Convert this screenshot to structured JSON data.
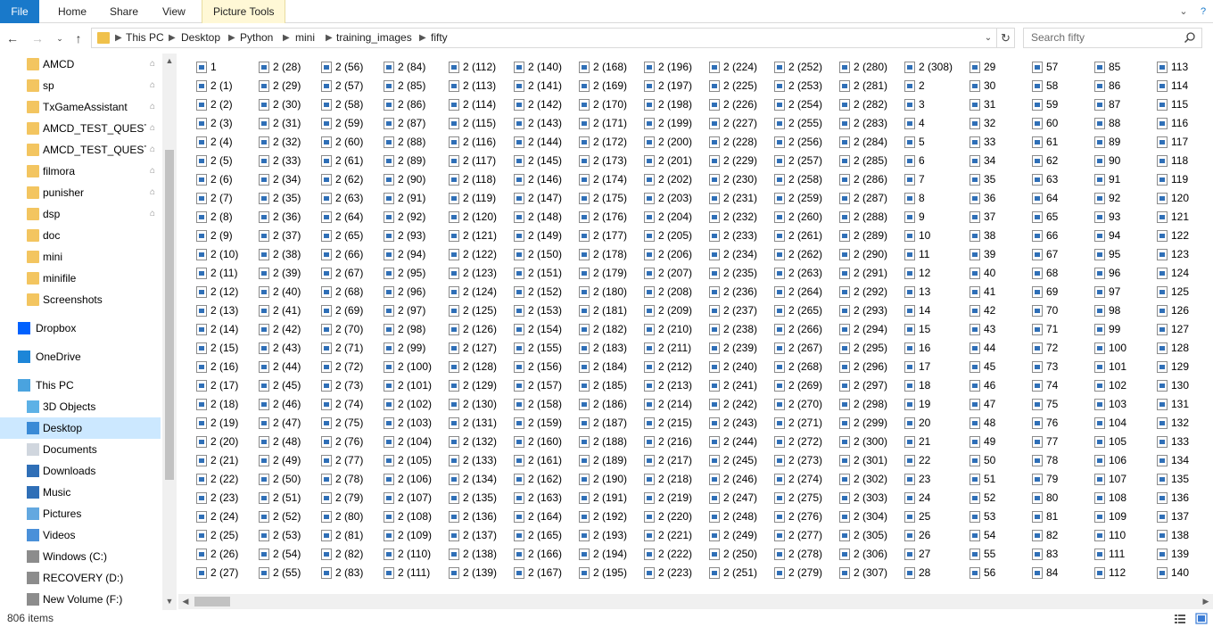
{
  "ribbon": {
    "file_label": "File",
    "tabs": [
      "Home",
      "Share",
      "View"
    ],
    "tools_label": "Picture Tools"
  },
  "address": {
    "crumbs": [
      "This PC",
      "Desktop",
      "Python",
      "mini",
      "training_images",
      "fifty"
    ],
    "search_placeholder": "Search fifty"
  },
  "nav": {
    "quick": [
      {
        "label": "AMCD",
        "pinned": true
      },
      {
        "label": "sp",
        "pinned": true
      },
      {
        "label": "TxGameAssistant",
        "pinned": true
      },
      {
        "label": "AMCD_TEST_QUESTIO",
        "pinned": true
      },
      {
        "label": "AMCD_TEST_QUESTIO",
        "pinned": true
      },
      {
        "label": "filmora",
        "pinned": true
      },
      {
        "label": "punisher",
        "pinned": true
      },
      {
        "label": "dsp",
        "pinned": true
      },
      {
        "label": "doc",
        "pinned": false
      },
      {
        "label": "mini",
        "pinned": false
      },
      {
        "label": "minifile",
        "pinned": false
      },
      {
        "label": "Screenshots",
        "pinned": false
      }
    ],
    "dropbox": "Dropbox",
    "onedrive": "OneDrive",
    "thispc": "This PC",
    "pc_items": [
      {
        "label": "3D Objects",
        "icon": "cube-icon"
      },
      {
        "label": "Desktop",
        "icon": "desktop-icon",
        "selected": true
      },
      {
        "label": "Documents",
        "icon": "documents-icon"
      },
      {
        "label": "Downloads",
        "icon": "download-icon"
      },
      {
        "label": "Music",
        "icon": "music-icon"
      },
      {
        "label": "Pictures",
        "icon": "pictures-icon"
      },
      {
        "label": "Videos",
        "icon": "videos-icon"
      },
      {
        "label": "Windows (C:)",
        "icon": "drive-icon"
      },
      {
        "label": "RECOVERY (D:)",
        "icon": "drive-icon"
      },
      {
        "label": "New Volume (F:)",
        "icon": "drive-icon"
      }
    ]
  },
  "files": {
    "columns": [
      [
        "1",
        "2 (1)",
        "2 (2)",
        "2 (3)",
        "2 (4)",
        "2 (5)",
        "2 (6)",
        "2 (7)",
        "2 (8)",
        "2 (9)",
        "2 (10)",
        "2 (11)",
        "2 (12)",
        "2 (13)",
        "2 (14)",
        "2 (15)",
        "2 (16)",
        "2 (17)",
        "2 (18)",
        "2 (19)",
        "2 (20)",
        "2 (21)",
        "2 (22)",
        "2 (23)",
        "2 (24)",
        "2 (25)",
        "2 (26)",
        "2 (27)"
      ],
      [
        "2 (28)",
        "2 (29)",
        "2 (30)",
        "2 (31)",
        "2 (32)",
        "2 (33)",
        "2 (34)",
        "2 (35)",
        "2 (36)",
        "2 (37)",
        "2 (38)",
        "2 (39)",
        "2 (40)",
        "2 (41)",
        "2 (42)",
        "2 (43)",
        "2 (44)",
        "2 (45)",
        "2 (46)",
        "2 (47)",
        "2 (48)",
        "2 (49)",
        "2 (50)",
        "2 (51)",
        "2 (52)",
        "2 (53)",
        "2 (54)",
        "2 (55)"
      ],
      [
        "2 (56)",
        "2 (57)",
        "2 (58)",
        "2 (59)",
        "2 (60)",
        "2 (61)",
        "2 (62)",
        "2 (63)",
        "2 (64)",
        "2 (65)",
        "2 (66)",
        "2 (67)",
        "2 (68)",
        "2 (69)",
        "2 (70)",
        "2 (71)",
        "2 (72)",
        "2 (73)",
        "2 (74)",
        "2 (75)",
        "2 (76)",
        "2 (77)",
        "2 (78)",
        "2 (79)",
        "2 (80)",
        "2 (81)",
        "2 (82)",
        "2 (83)"
      ],
      [
        "2 (84)",
        "2 (85)",
        "2 (86)",
        "2 (87)",
        "2 (88)",
        "2 (89)",
        "2 (90)",
        "2 (91)",
        "2 (92)",
        "2 (93)",
        "2 (94)",
        "2 (95)",
        "2 (96)",
        "2 (97)",
        "2 (98)",
        "2 (99)",
        "2 (100)",
        "2 (101)",
        "2 (102)",
        "2 (103)",
        "2 (104)",
        "2 (105)",
        "2 (106)",
        "2 (107)",
        "2 (108)",
        "2 (109)",
        "2 (110)",
        "2 (111)"
      ],
      [
        "2 (112)",
        "2 (113)",
        "2 (114)",
        "2 (115)",
        "2 (116)",
        "2 (117)",
        "2 (118)",
        "2 (119)",
        "2 (120)",
        "2 (121)",
        "2 (122)",
        "2 (123)",
        "2 (124)",
        "2 (125)",
        "2 (126)",
        "2 (127)",
        "2 (128)",
        "2 (129)",
        "2 (130)",
        "2 (131)",
        "2 (132)",
        "2 (133)",
        "2 (134)",
        "2 (135)",
        "2 (136)",
        "2 (137)",
        "2 (138)",
        "2 (139)"
      ],
      [
        "2 (140)",
        "2 (141)",
        "2 (142)",
        "2 (143)",
        "2 (144)",
        "2 (145)",
        "2 (146)",
        "2 (147)",
        "2 (148)",
        "2 (149)",
        "2 (150)",
        "2 (151)",
        "2 (152)",
        "2 (153)",
        "2 (154)",
        "2 (155)",
        "2 (156)",
        "2 (157)",
        "2 (158)",
        "2 (159)",
        "2 (160)",
        "2 (161)",
        "2 (162)",
        "2 (163)",
        "2 (164)",
        "2 (165)",
        "2 (166)",
        "2 (167)"
      ],
      [
        "2 (168)",
        "2 (169)",
        "2 (170)",
        "2 (171)",
        "2 (172)",
        "2 (173)",
        "2 (174)",
        "2 (175)",
        "2 (176)",
        "2 (177)",
        "2 (178)",
        "2 (179)",
        "2 (180)",
        "2 (181)",
        "2 (182)",
        "2 (183)",
        "2 (184)",
        "2 (185)",
        "2 (186)",
        "2 (187)",
        "2 (188)",
        "2 (189)",
        "2 (190)",
        "2 (191)",
        "2 (192)",
        "2 (193)",
        "2 (194)",
        "2 (195)"
      ],
      [
        "2 (196)",
        "2 (197)",
        "2 (198)",
        "2 (199)",
        "2 (200)",
        "2 (201)",
        "2 (202)",
        "2 (203)",
        "2 (204)",
        "2 (205)",
        "2 (206)",
        "2 (207)",
        "2 (208)",
        "2 (209)",
        "2 (210)",
        "2 (211)",
        "2 (212)",
        "2 (213)",
        "2 (214)",
        "2 (215)",
        "2 (216)",
        "2 (217)",
        "2 (218)",
        "2 (219)",
        "2 (220)",
        "2 (221)",
        "2 (222)",
        "2 (223)"
      ],
      [
        "2 (224)",
        "2 (225)",
        "2 (226)",
        "2 (227)",
        "2 (228)",
        "2 (229)",
        "2 (230)",
        "2 (231)",
        "2 (232)",
        "2 (233)",
        "2 (234)",
        "2 (235)",
        "2 (236)",
        "2 (237)",
        "2 (238)",
        "2 (239)",
        "2 (240)",
        "2 (241)",
        "2 (242)",
        "2 (243)",
        "2 (244)",
        "2 (245)",
        "2 (246)",
        "2 (247)",
        "2 (248)",
        "2 (249)",
        "2 (250)",
        "2 (251)"
      ],
      [
        "2 (252)",
        "2 (253)",
        "2 (254)",
        "2 (255)",
        "2 (256)",
        "2 (257)",
        "2 (258)",
        "2 (259)",
        "2 (260)",
        "2 (261)",
        "2 (262)",
        "2 (263)",
        "2 (264)",
        "2 (265)",
        "2 (266)",
        "2 (267)",
        "2 (268)",
        "2 (269)",
        "2 (270)",
        "2 (271)",
        "2 (272)",
        "2 (273)",
        "2 (274)",
        "2 (275)",
        "2 (276)",
        "2 (277)",
        "2 (278)",
        "2 (279)"
      ],
      [
        "2 (280)",
        "2 (281)",
        "2 (282)",
        "2 (283)",
        "2 (284)",
        "2 (285)",
        "2 (286)",
        "2 (287)",
        "2 (288)",
        "2 (289)",
        "2 (290)",
        "2 (291)",
        "2 (292)",
        "2 (293)",
        "2 (294)",
        "2 (295)",
        "2 (296)",
        "2 (297)",
        "2 (298)",
        "2 (299)",
        "2 (300)",
        "2 (301)",
        "2 (302)",
        "2 (303)",
        "2 (304)",
        "2 (305)",
        "2 (306)",
        "2 (307)"
      ],
      [
        "2 (308)",
        "2",
        "3",
        "4",
        "5",
        "6",
        "7",
        "8",
        "9",
        "10",
        "11",
        "12",
        "13",
        "14",
        "15",
        "16",
        "17",
        "18",
        "19",
        "20",
        "21",
        "22",
        "23",
        "24",
        "25",
        "26",
        "27",
        "28"
      ],
      [
        "29",
        "30",
        "31",
        "32",
        "33",
        "34",
        "35",
        "36",
        "37",
        "38",
        "39",
        "40",
        "41",
        "42",
        "43",
        "44",
        "45",
        "46",
        "47",
        "48",
        "49",
        "50",
        "51",
        "52",
        "53",
        "54",
        "55",
        "56"
      ],
      [
        "57",
        "58",
        "59",
        "60",
        "61",
        "62",
        "63",
        "64",
        "65",
        "66",
        "67",
        "68",
        "69",
        "70",
        "71",
        "72",
        "73",
        "74",
        "75",
        "76",
        "77",
        "78",
        "79",
        "80",
        "81",
        "82",
        "83",
        "84"
      ],
      [
        "85",
        "86",
        "87",
        "88",
        "89",
        "90",
        "91",
        "92",
        "93",
        "94",
        "95",
        "96",
        "97",
        "98",
        "99",
        "100",
        "101",
        "102",
        "103",
        "104",
        "105",
        "106",
        "107",
        "108",
        "109",
        "110",
        "111",
        "112"
      ],
      [
        "113",
        "114",
        "115",
        "116",
        "117",
        "118",
        "119",
        "120",
        "121",
        "122",
        "123",
        "124",
        "125",
        "126",
        "127",
        "128",
        "129",
        "130",
        "131",
        "132",
        "133",
        "134",
        "135",
        "136",
        "137",
        "138",
        "139",
        "140"
      ]
    ]
  },
  "status": {
    "count": "806 items"
  },
  "colors": {
    "file_tab": "#1979ca",
    "selection": "#cce8ff",
    "folder": "#f3c560",
    "tools_tab": "#fff8d6"
  }
}
